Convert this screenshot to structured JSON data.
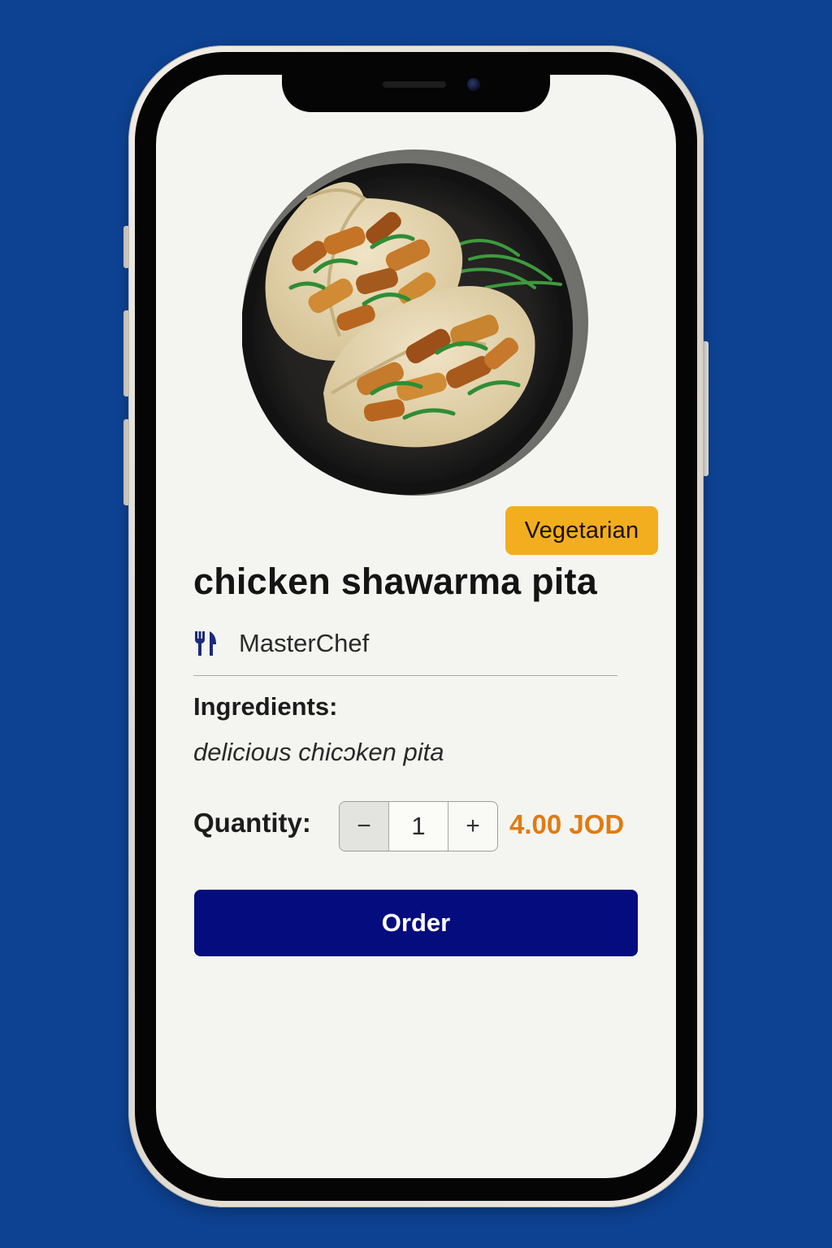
{
  "product": {
    "badge": "Vegetarian",
    "title": "chicken shawarma pita",
    "chef": "MasterChef",
    "chef_icon": "fork-knife-icon",
    "ingredients_heading": "Ingredients:",
    "ingredients_text": "delicious chicɔken pita"
  },
  "order": {
    "quantity_label": "Quantity:",
    "minus": "−",
    "quantity_value": "1",
    "plus": "+",
    "price": "4.00 JOD",
    "order_label": "Order"
  },
  "colors": {
    "background": "#0d4292",
    "badge": "#f2ae1f",
    "price": "#e07b12",
    "order_button": "#050c7e",
    "screen": "#f4f5f0"
  }
}
